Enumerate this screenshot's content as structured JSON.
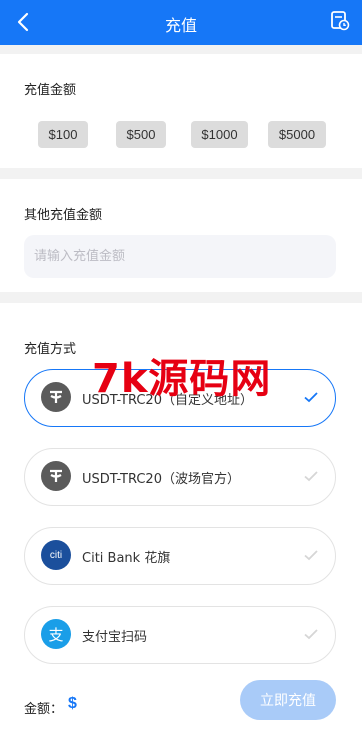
{
  "header": {
    "title": "充值",
    "back_icon": "chevron-left-icon",
    "record_icon": "history-icon"
  },
  "amount_section": {
    "label": "充值金额",
    "options": [
      "$100",
      "$500",
      "$1000",
      "$5000"
    ]
  },
  "other_amount": {
    "label": "其他充值金额",
    "placeholder": "请输入充值金额",
    "value": ""
  },
  "method_section": {
    "label": "充值方式",
    "methods": [
      {
        "label": "USDT-TRC20（自定义地址）",
        "icon": "tether-icon",
        "selected": true
      },
      {
        "label": "USDT-TRC20（波场官方）",
        "icon": "tether-icon",
        "selected": false
      },
      {
        "label": "Citi Bank 花旗",
        "icon": "citi-icon",
        "icon_text": "citi",
        "selected": false
      },
      {
        "label": "支付宝扫码",
        "icon": "alipay-icon",
        "icon_text": "支",
        "selected": false
      }
    ]
  },
  "footer": {
    "total_label": "金额：",
    "total_value": "$",
    "submit_label": "立即充值"
  },
  "watermark": "7k源码网",
  "colors": {
    "primary": "#1677f7",
    "submit_disabled": "#a9cbf8",
    "watermark": "#e60012"
  }
}
